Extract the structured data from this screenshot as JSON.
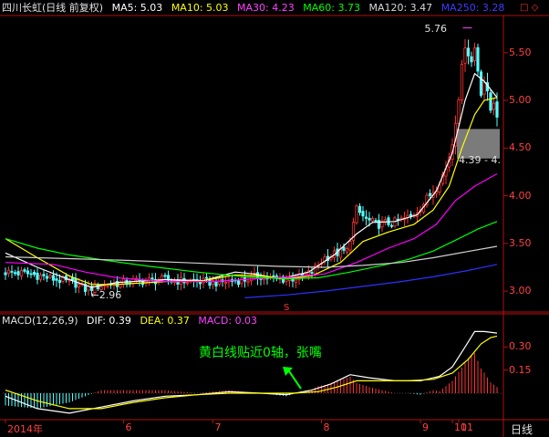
{
  "header": {
    "title": "四川长虹(日线 前复权)",
    "ma5_label": "MA5: 5.03",
    "ma10_label": "MA10: 5.03",
    "ma30_label": "MA30: 4.23",
    "ma60_label": "MA60: 3.73",
    "ma120_label": "MA120: 3.47",
    "ma250_label": "MA250: 3.28",
    "controls": "□ ◇"
  },
  "macd_header": {
    "title": "MACD(12,26,9)",
    "dif_label": "DIF: 0.39",
    "dea_label": "DEA: 0.37",
    "macd_label": "MACD: 0.03"
  },
  "annotation": "黄白线贴近0轴，张嘴",
  "period_label": "日线",
  "marker_label": "S",
  "colors": {
    "up": "#ff3232",
    "down": "#54ffff",
    "ma5": "#ffffff",
    "ma10": "#ffff00",
    "ma30": "#ff00ff",
    "ma60": "#00ff00",
    "ma120": "#d0d0d0",
    "ma250": "#3030ff",
    "axis": "#b01010",
    "text_white": "#e0e0e0"
  },
  "chart_data": {
    "type": "candlestick",
    "price_axis": {
      "ylim": [
        2.8,
        5.88
      ],
      "ticks": [
        3.0,
        3.5,
        4.0,
        4.5,
        5.0,
        5.5
      ]
    },
    "macd_axis": {
      "ylim": [
        -0.16,
        0.42
      ],
      "ticks": [
        0.15,
        0.3
      ]
    },
    "x_labels": [
      {
        "label": "2014年",
        "bar": 0
      },
      {
        "label": "6",
        "bar": 37
      },
      {
        "label": "7",
        "bar": 65
      },
      {
        "label": "8",
        "bar": 99
      },
      {
        "label": "9",
        "bar": 130
      },
      {
        "label": "10",
        "bar": 140
      },
      {
        "label": "11",
        "bar": 142
      }
    ],
    "extremes": {
      "high": {
        "value": 5.76,
        "bar": 145
      },
      "low": {
        "value": 2.96,
        "bar": 25
      },
      "range_text": "4.39 - 4."
    },
    "highlight_range": [
      4.39,
      4.7
    ],
    "annotation_bar": 94,
    "marker_bar": 88,
    "price_path": [
      [
        0,
        3.2
      ],
      [
        8,
        3.18
      ],
      [
        16,
        3.12
      ],
      [
        22,
        3.08
      ],
      [
        25,
        3.02
      ],
      [
        30,
        3.06
      ],
      [
        40,
        3.1
      ],
      [
        50,
        3.12
      ],
      [
        58,
        3.1
      ],
      [
        66,
        3.09
      ],
      [
        75,
        3.12
      ],
      [
        80,
        3.16
      ],
      [
        85,
        3.12
      ],
      [
        92,
        3.14
      ],
      [
        96,
        3.2
      ],
      [
        100,
        3.35
      ],
      [
        104,
        3.4
      ],
      [
        107,
        3.42
      ],
      [
        110,
        3.85
      ],
      [
        113,
        3.75
      ],
      [
        116,
        3.7
      ],
      [
        122,
        3.72
      ],
      [
        127,
        3.78
      ],
      [
        131,
        3.92
      ],
      [
        135,
        4.1
      ],
      [
        138,
        4.28
      ],
      [
        140,
        4.55
      ],
      [
        142,
        5.05
      ],
      [
        144,
        5.6
      ],
      [
        146,
        5.4
      ],
      [
        147,
        5.55
      ],
      [
        149,
        5.1
      ],
      [
        150,
        5.2
      ],
      [
        152,
        4.9
      ],
      [
        153,
        5.0
      ],
      [
        154,
        4.86
      ]
    ],
    "ma": {
      "MA5": [
        [
          0,
          3.4
        ],
        [
          10,
          3.25
        ],
        [
          20,
          3.12
        ],
        [
          27,
          3.04
        ],
        [
          35,
          3.09
        ],
        [
          50,
          3.12
        ],
        [
          62,
          3.11
        ],
        [
          72,
          3.2
        ],
        [
          78,
          3.18
        ],
        [
          86,
          3.13
        ],
        [
          95,
          3.2
        ],
        [
          103,
          3.38
        ],
        [
          110,
          3.6
        ],
        [
          115,
          3.72
        ],
        [
          122,
          3.73
        ],
        [
          129,
          3.8
        ],
        [
          135,
          4.05
        ],
        [
          140,
          4.45
        ],
        [
          144,
          5.0
        ],
        [
          147,
          5.28
        ],
        [
          150,
          5.2
        ],
        [
          154,
          5.03
        ]
      ],
      "MA10": [
        [
          0,
          3.55
        ],
        [
          10,
          3.35
        ],
        [
          20,
          3.16
        ],
        [
          27,
          3.07
        ],
        [
          35,
          3.07
        ],
        [
          50,
          3.1
        ],
        [
          62,
          3.11
        ],
        [
          72,
          3.17
        ],
        [
          80,
          3.16
        ],
        [
          88,
          3.13
        ],
        [
          96,
          3.16
        ],
        [
          105,
          3.3
        ],
        [
          112,
          3.52
        ],
        [
          120,
          3.62
        ],
        [
          128,
          3.7
        ],
        [
          134,
          3.85
        ],
        [
          139,
          4.1
        ],
        [
          143,
          4.5
        ],
        [
          147,
          4.85
        ],
        [
          150,
          5.0
        ],
        [
          154,
          5.03
        ]
      ],
      "MA30": [
        [
          0,
          3.3
        ],
        [
          15,
          3.28
        ],
        [
          25,
          3.2
        ],
        [
          35,
          3.14
        ],
        [
          50,
          3.1
        ],
        [
          65,
          3.1
        ],
        [
          78,
          3.13
        ],
        [
          90,
          3.15
        ],
        [
          100,
          3.18
        ],
        [
          110,
          3.3
        ],
        [
          120,
          3.45
        ],
        [
          128,
          3.55
        ],
        [
          135,
          3.7
        ],
        [
          141,
          3.95
        ],
        [
          147,
          4.1
        ],
        [
          154,
          4.23
        ]
      ],
      "MA60": [
        [
          0,
          3.55
        ],
        [
          10,
          3.45
        ],
        [
          20,
          3.38
        ],
        [
          32,
          3.32
        ],
        [
          45,
          3.26
        ],
        [
          60,
          3.2
        ],
        [
          75,
          3.15
        ],
        [
          88,
          3.13
        ],
        [
          98,
          3.14
        ],
        [
          108,
          3.2
        ],
        [
          118,
          3.27
        ],
        [
          126,
          3.33
        ],
        [
          134,
          3.42
        ],
        [
          142,
          3.55
        ],
        [
          148,
          3.65
        ],
        [
          154,
          3.73
        ]
      ],
      "MA120": [
        [
          0,
          3.36
        ],
        [
          20,
          3.34
        ],
        [
          40,
          3.32
        ],
        [
          55,
          3.3
        ],
        [
          70,
          3.28
        ],
        [
          85,
          3.26
        ],
        [
          100,
          3.25
        ],
        [
          112,
          3.27
        ],
        [
          124,
          3.3
        ],
        [
          134,
          3.35
        ],
        [
          144,
          3.41
        ],
        [
          154,
          3.47
        ]
      ],
      "MA250": [
        [
          75,
          2.93
        ],
        [
          88,
          2.96
        ],
        [
          100,
          3.0
        ],
        [
          112,
          3.05
        ],
        [
          124,
          3.1
        ],
        [
          134,
          3.15
        ],
        [
          144,
          3.21
        ],
        [
          154,
          3.28
        ]
      ]
    },
    "macd": {
      "DIF": [
        [
          0,
          -0.02
        ],
        [
          10,
          -0.1
        ],
        [
          20,
          -0.13
        ],
        [
          30,
          -0.09
        ],
        [
          40,
          -0.05
        ],
        [
          50,
          -0.02
        ],
        [
          60,
          -0.01
        ],
        [
          70,
          0.01
        ],
        [
          80,
          0.0
        ],
        [
          88,
          -0.01
        ],
        [
          96,
          0.02
        ],
        [
          102,
          0.06
        ],
        [
          108,
          0.12
        ],
        [
          114,
          0.1
        ],
        [
          122,
          0.08
        ],
        [
          130,
          0.08
        ],
        [
          136,
          0.11
        ],
        [
          140,
          0.17
        ],
        [
          144,
          0.3
        ],
        [
          147,
          0.4
        ],
        [
          150,
          0.4
        ],
        [
          154,
          0.39
        ]
      ],
      "DEA": [
        [
          0,
          0.02
        ],
        [
          10,
          -0.05
        ],
        [
          20,
          -0.1
        ],
        [
          30,
          -0.1
        ],
        [
          40,
          -0.06
        ],
        [
          50,
          -0.03
        ],
        [
          60,
          -0.01
        ],
        [
          70,
          0.0
        ],
        [
          80,
          0.0
        ],
        [
          90,
          0.0
        ],
        [
          98,
          0.01
        ],
        [
          104,
          0.04
        ],
        [
          110,
          0.08
        ],
        [
          118,
          0.08
        ],
        [
          126,
          0.08
        ],
        [
          134,
          0.09
        ],
        [
          140,
          0.13
        ],
        [
          145,
          0.22
        ],
        [
          149,
          0.32
        ],
        [
          152,
          0.36
        ],
        [
          154,
          0.37
        ]
      ]
    }
  }
}
